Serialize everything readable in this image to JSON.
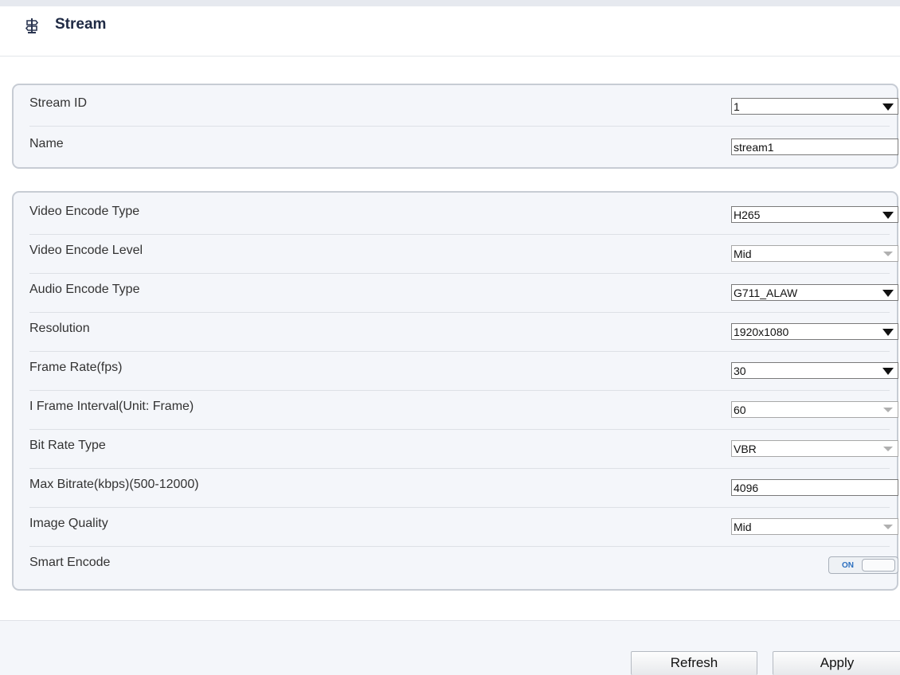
{
  "header": {
    "title": "Stream",
    "icon": "signpost-icon"
  },
  "stream_panel": {
    "rows": [
      {
        "label": "Stream ID",
        "value": "1",
        "kind": "select",
        "enabled": true
      },
      {
        "label": "Name",
        "value": "stream1",
        "kind": "input"
      }
    ]
  },
  "encode_panel": {
    "rows": [
      {
        "label": "Video Encode Type",
        "value": "H265",
        "kind": "select",
        "enabled": true
      },
      {
        "label": "Video Encode Level",
        "value": "Mid",
        "kind": "select",
        "enabled": false
      },
      {
        "label": "Audio Encode Type",
        "value": "G711_ALAW",
        "kind": "select",
        "enabled": true
      },
      {
        "label": "Resolution",
        "value": "1920x1080",
        "kind": "select",
        "enabled": true
      },
      {
        "label": "Frame Rate(fps)",
        "value": "30",
        "kind": "select",
        "enabled": true
      },
      {
        "label": "I Frame Interval(Unit: Frame)",
        "value": "60",
        "kind": "select",
        "enabled": false
      },
      {
        "label": "Bit Rate Type",
        "value": "VBR",
        "kind": "select",
        "enabled": false
      },
      {
        "label": "Max Bitrate(kbps)(500-12000)",
        "value": "4096",
        "kind": "input"
      },
      {
        "label": "Image Quality",
        "value": "Mid",
        "kind": "select",
        "enabled": false
      },
      {
        "label": "Smart Encode",
        "value": "ON",
        "kind": "toggle"
      }
    ]
  },
  "buttons": {
    "refresh": "Refresh",
    "apply": "Apply"
  },
  "colors": {
    "title": "#1f2a44",
    "panel_border": "#c7ccd4",
    "toggle_text": "#2c6fbf"
  }
}
